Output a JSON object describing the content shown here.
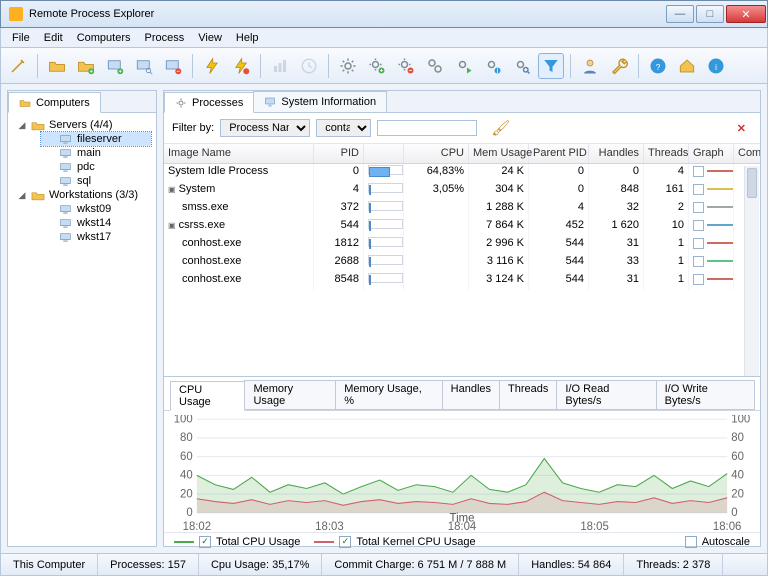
{
  "window": {
    "title": "Remote Process Explorer"
  },
  "menu": {
    "file": "File",
    "edit": "Edit",
    "computers": "Computers",
    "process": "Process",
    "view": "View",
    "help": "Help"
  },
  "left_tab": {
    "label": "Computers"
  },
  "tree": {
    "servers_label": "Servers (4/4)",
    "servers": [
      "fileserver",
      "main",
      "pdc",
      "sql"
    ],
    "ws_label": "Workstations (3/3)",
    "ws": [
      "wkst09",
      "wkst14",
      "wkst17"
    ],
    "selected": "fileserver"
  },
  "right_tabs": {
    "processes": "Processes",
    "sysinfo": "System Information"
  },
  "filter": {
    "label": "Filter by:",
    "field": "Process Name",
    "op": "contains",
    "value": ""
  },
  "columns": {
    "name": "Image Name",
    "pid": "PID",
    "cpu": "CPU",
    "mem": "Mem Usage",
    "ppid": "Parent PID",
    "handles": "Handles",
    "threads": "Threads",
    "graph": "Graph",
    "cmd": "Command Line"
  },
  "processes": [
    {
      "name": "System Idle Process",
      "depth": 0,
      "exp": "",
      "pid": 0,
      "cpu": "64,83%",
      "cpubar": 0.65,
      "mem": "24 K",
      "ppid": 0,
      "handles": 0,
      "threads": 4,
      "color": "#c0392b"
    },
    {
      "name": "System",
      "depth": 0,
      "exp": "▣",
      "pid": 4,
      "cpu": "3,05%",
      "cpubar": 0.03,
      "mem": "304 K",
      "ppid": 0,
      "handles": 848,
      "threads": 161,
      "color": "#d4ac0d"
    },
    {
      "name": "smss.exe",
      "depth": 1,
      "exp": "",
      "pid": 372,
      "cpu": "",
      "cpubar": 0,
      "mem": "1 288 K",
      "ppid": 4,
      "handles": 32,
      "threads": 2,
      "color": "#7f8c8d"
    },
    {
      "name": "csrss.exe",
      "depth": 0,
      "exp": "▣",
      "pid": 544,
      "cpu": "",
      "cpubar": 0,
      "mem": "7 864 K",
      "ppid": 452,
      "handles": "1 620",
      "threads": 10,
      "color": "#2e86c1"
    },
    {
      "name": "conhost.exe",
      "depth": 1,
      "exp": "",
      "pid": 1812,
      "cpu": "",
      "cpubar": 0,
      "mem": "2 996 K",
      "ppid": 544,
      "handles": 31,
      "threads": 1,
      "color": "#c0392b"
    },
    {
      "name": "conhost.exe",
      "depth": 1,
      "exp": "",
      "pid": 2688,
      "cpu": "",
      "cpubar": 0,
      "mem": "3 116 K",
      "ppid": 544,
      "handles": 33,
      "threads": 1,
      "color": "#27ae60"
    },
    {
      "name": "conhost.exe",
      "depth": 1,
      "exp": "",
      "pid": 8548,
      "cpu": "",
      "cpubar": 0,
      "mem": "3 124 K",
      "ppid": 544,
      "handles": 31,
      "threads": 1,
      "color": "#c0392b"
    }
  ],
  "chart_tabs": [
    "CPU Usage",
    "Memory Usage",
    "Memory Usage, %",
    "Handles",
    "Threads",
    "I/O Read Bytes/s",
    "I/O Write Bytes/s"
  ],
  "chart_data": {
    "type": "line",
    "title": "",
    "xlabel": "Time",
    "ylabel": "",
    "ylim": [
      0,
      100
    ],
    "yticks": [
      0,
      20,
      40,
      60,
      80,
      100
    ],
    "xticks": [
      "18:02",
      "18:03",
      "18:04",
      "18:05",
      "18:06"
    ],
    "series": [
      {
        "name": "Total CPU Usage",
        "color": "#4aa84a",
        "values": [
          40,
          30,
          25,
          38,
          22,
          30,
          26,
          32,
          20,
          28,
          35,
          24,
          30,
          28,
          22,
          40,
          25,
          22,
          30,
          58,
          32,
          26,
          22,
          30,
          28,
          40,
          26,
          34,
          28,
          42
        ]
      },
      {
        "name": "Total Kernel CPU Usage",
        "color": "#d0606a",
        "values": [
          15,
          12,
          10,
          14,
          9,
          13,
          11,
          13,
          8,
          12,
          14,
          10,
          12,
          11,
          9,
          15,
          10,
          9,
          12,
          22,
          13,
          11,
          9,
          12,
          11,
          16,
          10,
          13,
          11,
          16
        ]
      }
    ],
    "autoscale_label": "Autoscale",
    "autoscale_checked": false
  },
  "status": {
    "host": "This Computer",
    "processes": "Processes: 157",
    "cpu": "Cpu Usage: 35,17%",
    "commit": "Commit Charge: 6 751 M / 7 888 M",
    "handles": "Handles: 54 864",
    "threads": "Threads: 2 378"
  }
}
